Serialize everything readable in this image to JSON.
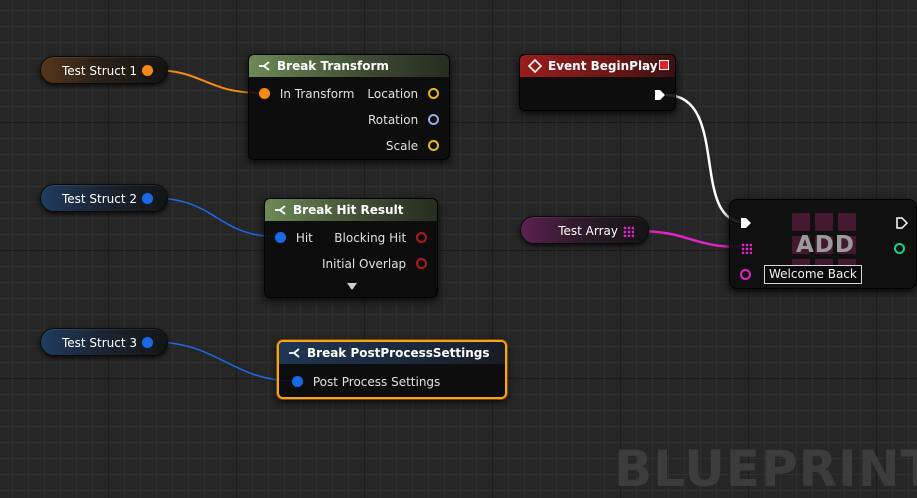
{
  "variables": [
    {
      "label": "Test Struct 1"
    },
    {
      "label": "Test Struct 2"
    },
    {
      "label": "Test Struct 3"
    },
    {
      "label": "Test Array"
    }
  ],
  "break_transform": {
    "title": "Break Transform",
    "input": "In Transform",
    "outputs": [
      "Location",
      "Rotation",
      "Scale"
    ]
  },
  "break_hit_result": {
    "title": "Break Hit Result",
    "input": "Hit",
    "outputs": [
      "Blocking Hit",
      "Initial Overlap"
    ]
  },
  "break_post_process": {
    "title": "Break PostProcessSettings",
    "input": "Post Process Settings"
  },
  "event_begin_play": {
    "title": "Event BeginPlay"
  },
  "add_node": {
    "title": "ADD",
    "input_value": "Welcome Back"
  },
  "watermark": "BLUEPRINT",
  "colors": {
    "struct_transform": "#f58a16",
    "struct_generic": "#1a6ae8",
    "array_string": "#e023c8",
    "exec": "#ffffff",
    "vector": "#e5bb1c",
    "rotator": "#9aa8e8",
    "bool": "#b11a1a",
    "int": "#1ccf8a",
    "selection": "#f4a51a"
  },
  "icons": [
    "break-struct-icon",
    "event-icon",
    "delegate-icon",
    "collapse-arrow-icon"
  ]
}
